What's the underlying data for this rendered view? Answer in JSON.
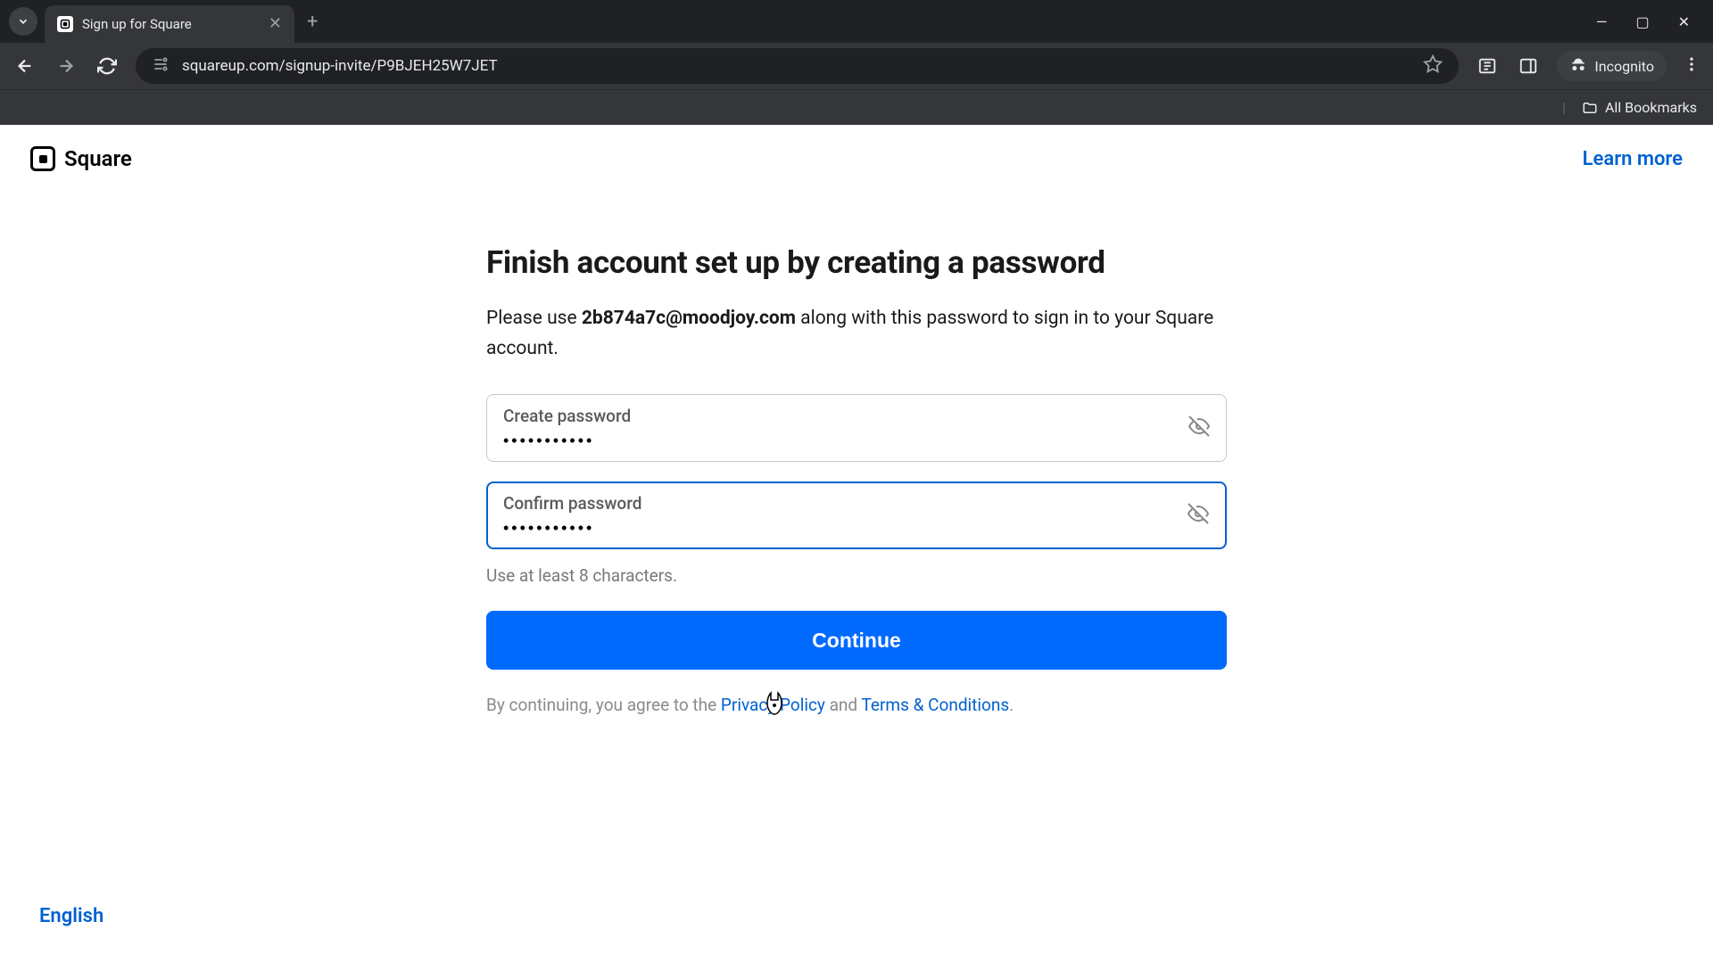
{
  "browser": {
    "tab_title": "Sign up for Square",
    "url": "squareup.com/signup-invite/P9BJEH25W7JET",
    "incognito_label": "Incognito",
    "all_bookmarks_label": "All Bookmarks"
  },
  "header": {
    "brand": "Square",
    "learn_more": "Learn more"
  },
  "form": {
    "headline": "Finish account set up by creating a password",
    "subtext_before": "Please use ",
    "email": "2b874a7c@moodjoy.com",
    "subtext_after": " along with this password to sign in to your Square account.",
    "create_password_label": "Create password",
    "create_password_value": "•••••••••••",
    "confirm_password_label": "Confirm password",
    "confirm_password_value": "•••••••••••",
    "hint": "Use at least 8 characters.",
    "continue_label": "Continue",
    "legal_before": "By continuing, you agree to the ",
    "privacy_label": "Privacy Policy",
    "legal_mid": " and ",
    "terms_label": "Terms & Conditions",
    "legal_after": "."
  },
  "footer": {
    "language": "English"
  }
}
